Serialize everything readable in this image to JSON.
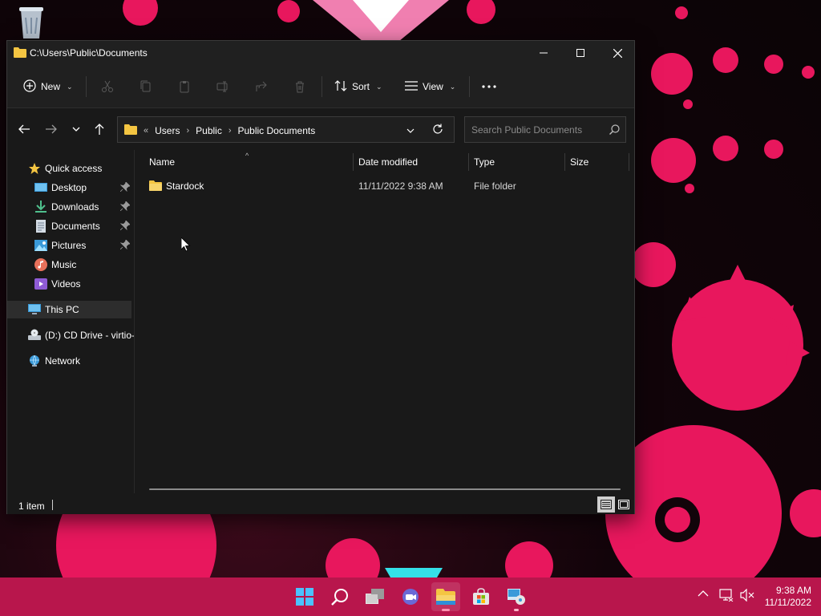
{
  "window": {
    "title": "C:\\Users\\Public\\Documents",
    "controls": {
      "minimize": "minimize",
      "maximize": "maximize",
      "close": "close"
    }
  },
  "toolbar": {
    "new_label": "New",
    "sort_label": "Sort",
    "view_label": "View",
    "icons": [
      "cut-icon",
      "copy-icon",
      "paste-icon",
      "rename-icon",
      "share-icon",
      "delete-icon",
      "more-icon"
    ]
  },
  "address": {
    "overflow": "«",
    "crumbs": [
      "Users",
      "Public",
      "Public Documents"
    ]
  },
  "search": {
    "placeholder": "Search Public Documents"
  },
  "sidebar": {
    "quick_access": "Quick access",
    "items": [
      {
        "label": "Desktop",
        "icon": "desktop-icon",
        "pinned": true
      },
      {
        "label": "Downloads",
        "icon": "downloads-icon",
        "pinned": true
      },
      {
        "label": "Documents",
        "icon": "documents-icon",
        "pinned": true
      },
      {
        "label": "Pictures",
        "icon": "pictures-icon",
        "pinned": true
      },
      {
        "label": "Music",
        "icon": "music-icon",
        "pinned": false
      },
      {
        "label": "Videos",
        "icon": "videos-icon",
        "pinned": false
      }
    ],
    "this_pc": "This PC",
    "cd_drive": "(D:) CD Drive - virtio-",
    "network": "Network"
  },
  "columns": [
    "Name",
    "Date modified",
    "Type",
    "Size"
  ],
  "files": [
    {
      "name": "Stardock",
      "date": "11/11/2022 9:38 AM",
      "type": "File folder",
      "size": ""
    }
  ],
  "status": {
    "count": "1 item"
  },
  "taskbar": {
    "apps": [
      "start-icon",
      "search-icon",
      "task-view-icon",
      "chat-icon",
      "file-explorer-icon",
      "store-icon",
      "app-installer-icon"
    ],
    "time": "9:38 AM",
    "date": "11/11/2022"
  },
  "colors": {
    "accent": "#b8164c",
    "wallpaper_pink": "#e8175d",
    "folder": "#f4c542",
    "window_bg": "#191919"
  }
}
